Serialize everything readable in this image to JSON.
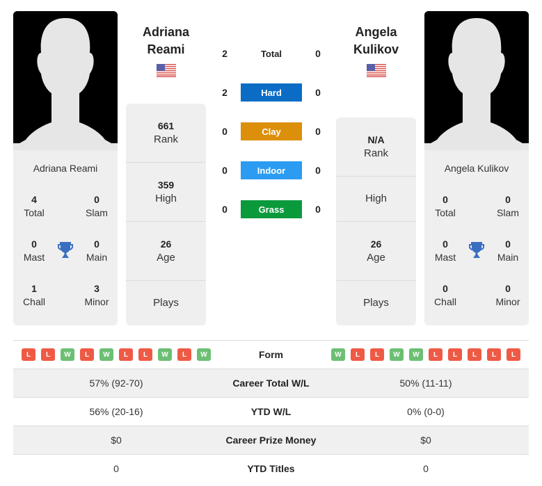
{
  "player1": {
    "name": "Adriana Reami",
    "header_first": "Adriana",
    "header_last": "Reami",
    "flag": "us-flag",
    "card_stats": {
      "total": {
        "value": "4",
        "label": "Total"
      },
      "slam": {
        "value": "0",
        "label": "Slam"
      },
      "mast": {
        "value": "0",
        "label": "Mast"
      },
      "main": {
        "value": "0",
        "label": "Main"
      },
      "chall": {
        "value": "1",
        "label": "Chall"
      },
      "minor": {
        "value": "3",
        "label": "Minor"
      }
    },
    "info": {
      "rank": {
        "value": "661",
        "label": "Rank"
      },
      "high": {
        "value": "359",
        "label": "High"
      },
      "age": {
        "value": "26",
        "label": "Age"
      },
      "plays": {
        "value": "",
        "label": "Plays"
      }
    },
    "form": [
      "L",
      "L",
      "W",
      "L",
      "W",
      "L",
      "L",
      "W",
      "L",
      "W"
    ]
  },
  "player2": {
    "name": "Angela Kulikov",
    "header_first": "Angela",
    "header_last": "Kulikov",
    "flag": "us-flag",
    "card_stats": {
      "total": {
        "value": "0",
        "label": "Total"
      },
      "slam": {
        "value": "0",
        "label": "Slam"
      },
      "mast": {
        "value": "0",
        "label": "Mast"
      },
      "main": {
        "value": "0",
        "label": "Main"
      },
      "chall": {
        "value": "0",
        "label": "Chall"
      },
      "minor": {
        "value": "0",
        "label": "Minor"
      }
    },
    "info": {
      "rank": {
        "value": "N/A",
        "label": "Rank"
      },
      "high": {
        "value": "",
        "label": "High"
      },
      "age": {
        "value": "26",
        "label": "Age"
      },
      "plays": {
        "value": "",
        "label": "Plays"
      }
    },
    "form": [
      "W",
      "L",
      "L",
      "W",
      "W",
      "L",
      "L",
      "L",
      "L",
      "L"
    ]
  },
  "h2h": [
    {
      "label": "Total",
      "p1": "2",
      "p2": "0",
      "color": ""
    },
    {
      "label": "Hard",
      "p1": "2",
      "p2": "0",
      "color": "#0a6cc4"
    },
    {
      "label": "Clay",
      "p1": "0",
      "p2": "0",
      "color": "#dc8f0b"
    },
    {
      "label": "Indoor",
      "p1": "0",
      "p2": "0",
      "color": "#2b9cf2"
    },
    {
      "label": "Grass",
      "p1": "0",
      "p2": "0",
      "color": "#0a9a3c"
    }
  ],
  "form_label": "Form",
  "comparison": [
    {
      "label": "Career Total W/L",
      "p1": "57% (92-70)",
      "p2": "50% (11-11)"
    },
    {
      "label": "YTD W/L",
      "p1": "56% (20-16)",
      "p2": "0% (0-0)"
    },
    {
      "label": "Career Prize Money",
      "p1": "$0",
      "p2": "$0"
    },
    {
      "label": "YTD Titles",
      "p1": "0",
      "p2": "0"
    }
  ],
  "colors": {
    "trophy": "#3a6fc0",
    "win": "#6cbf73",
    "loss": "#ee5a45"
  }
}
